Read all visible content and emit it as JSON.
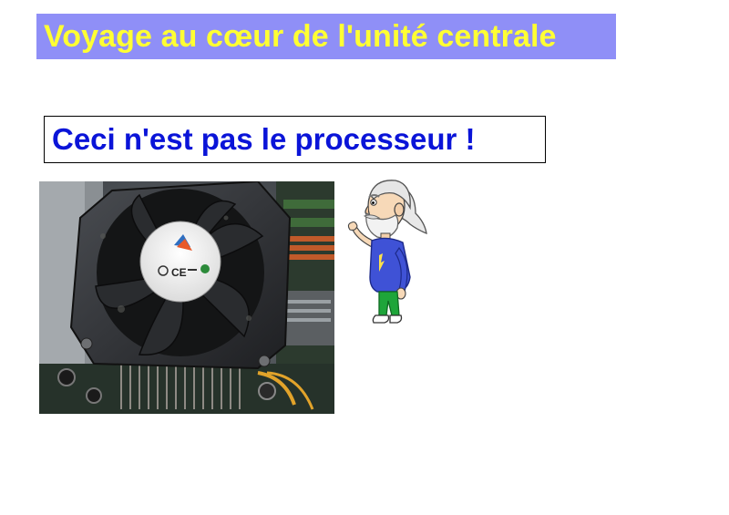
{
  "slide": {
    "title": "Voyage au cœur de l'unité centrale",
    "caption": "Ceci n'est pas le processeur !"
  },
  "photo": {
    "subject": "cpu-cooler-fan-photo"
  },
  "character": {
    "subject": "bearded-old-man-mascot"
  },
  "colors": {
    "title_background": "#8f8ff7",
    "title_text": "#ffff33",
    "caption_text": "#0a14d8",
    "caption_border": "#000000"
  }
}
